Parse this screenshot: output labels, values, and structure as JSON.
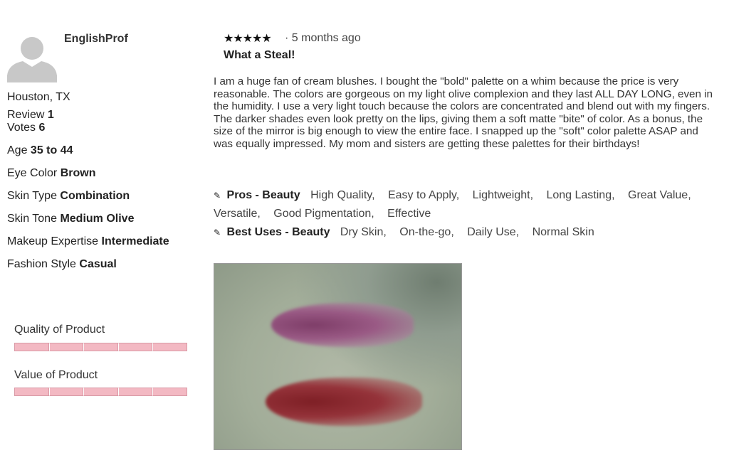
{
  "reviewer": {
    "username": "EnglishProf",
    "location": "Houston, TX",
    "review_label": "Review",
    "review_count": "1",
    "votes_label": "Votes",
    "votes_count": "6",
    "attributes": [
      {
        "label": "Age",
        "value": "35 to 44"
      },
      {
        "label": "Eye Color",
        "value": "Brown"
      },
      {
        "label": "Skin Type",
        "value": "Combination"
      },
      {
        "label": "Skin Tone",
        "value": "Medium Olive"
      },
      {
        "label": "Makeup Expertise",
        "value": "Intermediate"
      },
      {
        "label": "Fashion Style",
        "value": "Casual"
      }
    ]
  },
  "ratings": [
    {
      "label": "Quality of Product",
      "value": 5,
      "max": 5
    },
    {
      "label": "Value of Product",
      "value": 5,
      "max": 5
    }
  ],
  "review": {
    "stars": "★★★★★",
    "rating": 5,
    "age": "· 5 months ago",
    "title": "What a Steal!",
    "body": "I am a huge fan of cream blushes. I bought the \"bold\" palette on a whim because the price is very reasonable. The colors are gorgeous on my light olive complexion and they last ALL DAY LONG, even in the humidity. I use a very light touch because the colors are concentrated and blend out with my fingers. The darker shades even look pretty on the lips, giving them a soft matte \"bite\" of color. As a bonus, the size of the mirror is big enough to view the entire face. I snapped up the \"soft\" color palette ASAP and was equally impressed. My mom and sisters are getting these palettes for their birthdays!"
  },
  "tags": {
    "pros_label": "Pros - Beauty",
    "pros": [
      "High Quality,",
      "Easy to Apply,",
      "Lightweight,",
      "Long Lasting,",
      "Great Value,",
      "Versatile,",
      "Good Pigmentation,",
      "Effective"
    ],
    "best_uses_label": "Best Uses - Beauty",
    "best_uses": [
      "Dry Skin,",
      "On-the-go,",
      "Daily Use,",
      "Normal Skin"
    ]
  },
  "icons": {
    "avatar": "user-silhouette-icon",
    "tag": "tag-icon"
  },
  "colors": {
    "rating_bar": "#f3b9c3",
    "swatch_plum": "#7e3d68",
    "swatch_red": "#7e1f25"
  }
}
